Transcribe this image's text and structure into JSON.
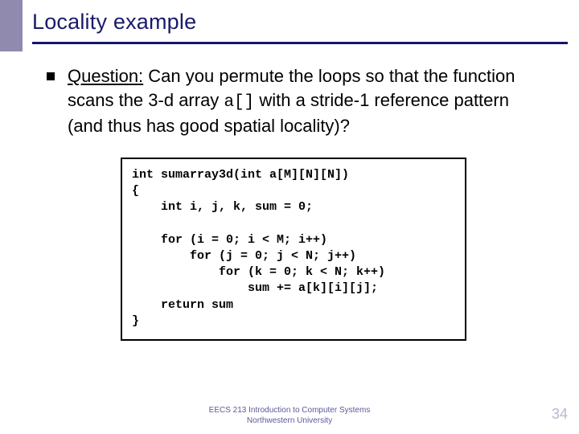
{
  "title": "Locality example",
  "question": {
    "label": "Question:",
    "before_code": " Can you permute the loops so that the function scans the 3-d array ",
    "code_inline": "a[]",
    "after_code": " with a stride-1 reference pattern (and thus has good spatial locality)?"
  },
  "code": "int sumarray3d(int a[M][N][N])\n{\n    int i, j, k, sum = 0;\n\n    for (i = 0; i < M; i++)\n        for (j = 0; j < N; j++)\n            for (k = 0; k < N; k++)\n                sum += a[k][i][j];\n    return sum\n}",
  "footer": {
    "line1": "EECS 213 Introduction to Computer Systems",
    "line2": "Northwestern University"
  },
  "page_number": "34"
}
